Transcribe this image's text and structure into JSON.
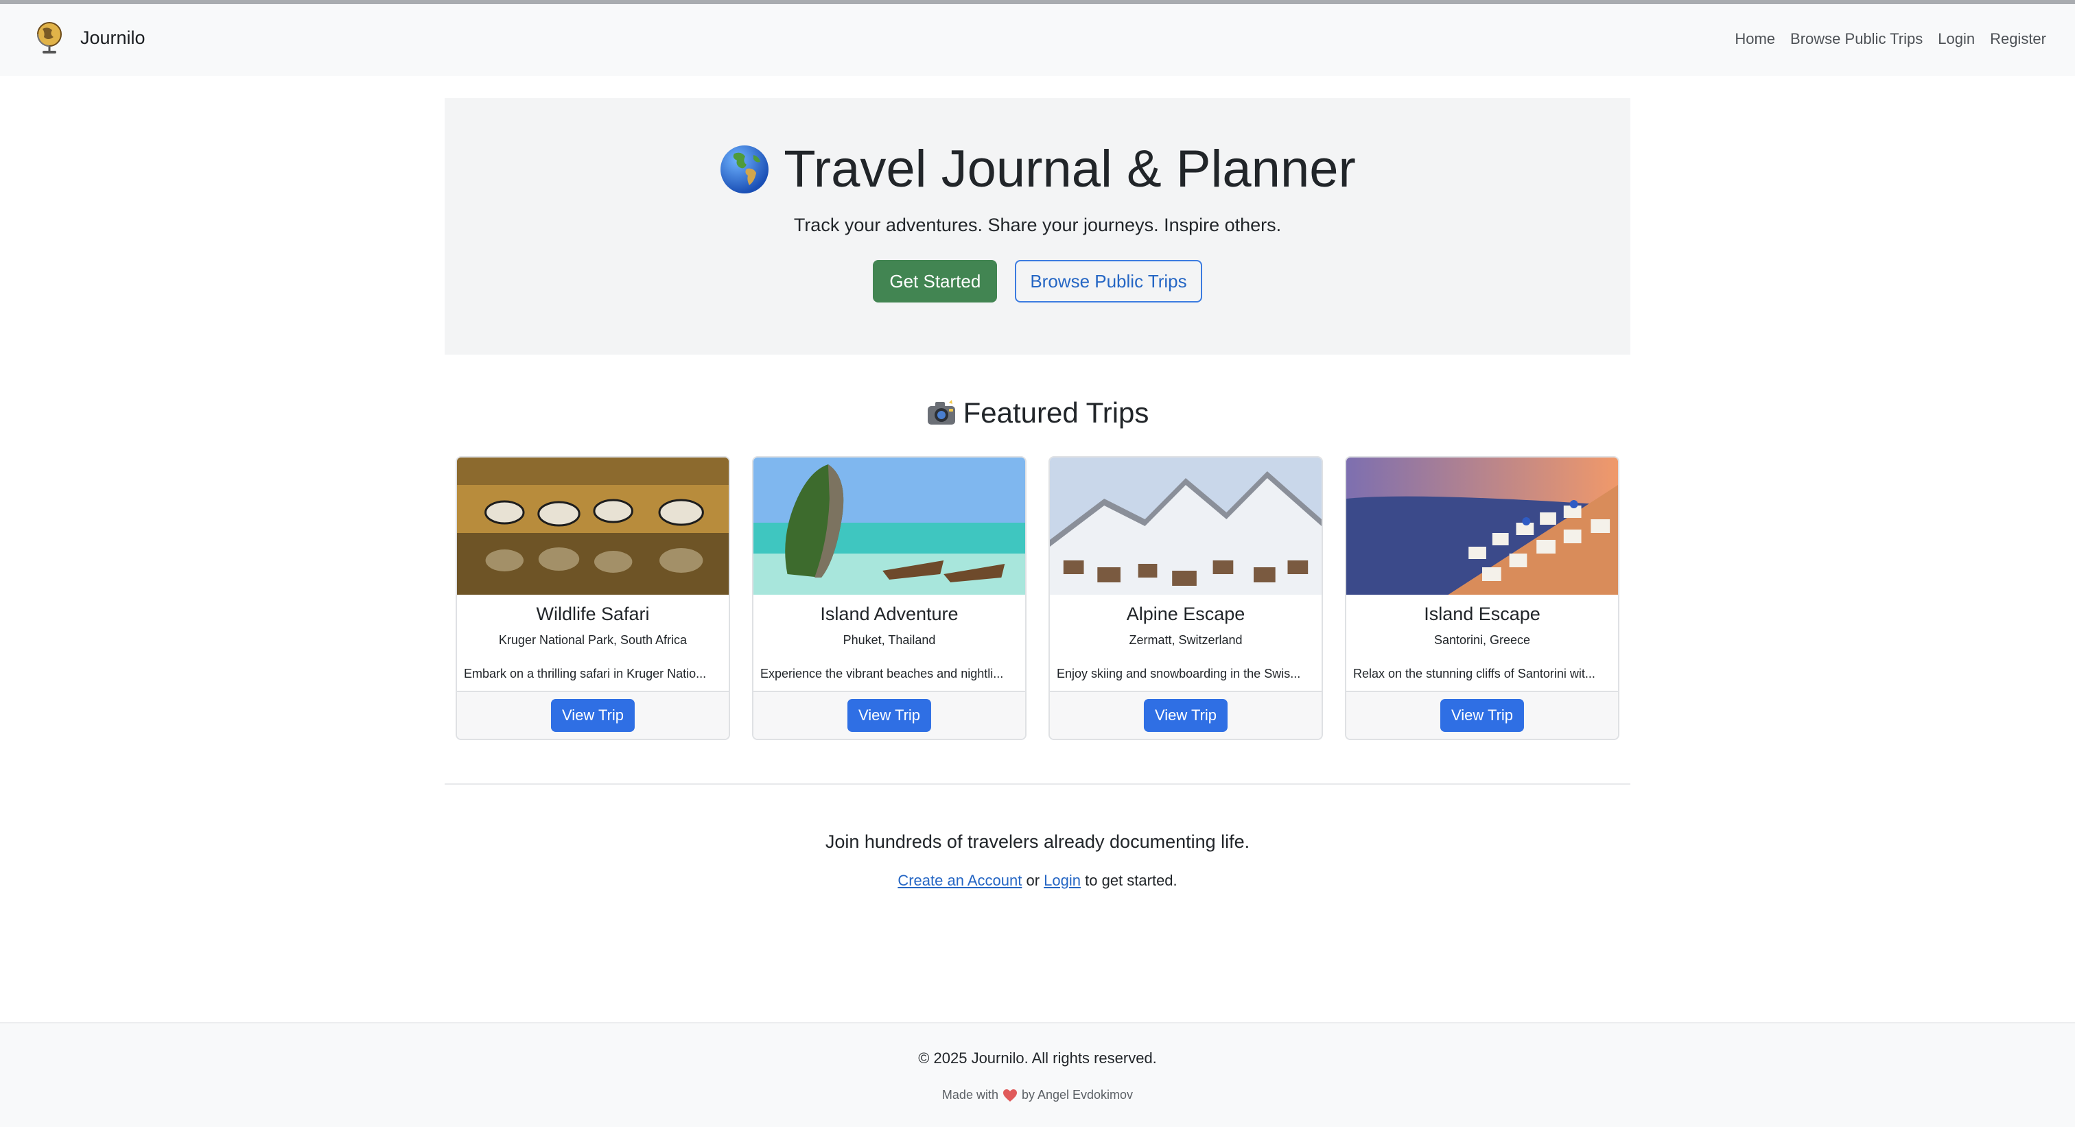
{
  "navbar": {
    "brand": "Journilo",
    "links": [
      "Home",
      "Browse Public Trips",
      "Login",
      "Register"
    ]
  },
  "hero": {
    "title": "Travel Journal & Planner",
    "subtitle": "Track your adventures. Share your journeys. Inspire others.",
    "primary_button": "Get Started",
    "secondary_button": "Browse Public Trips"
  },
  "featured": {
    "heading": "Featured Trips",
    "cards": [
      {
        "title": "Wildlife Safari",
        "location": "Kruger National Park, South Africa",
        "description": "Embark on a thrilling safari in Kruger Natio...",
        "button": "View Trip"
      },
      {
        "title": "Island Adventure",
        "location": "Phuket, Thailand",
        "description": "Experience the vibrant beaches and nightli...",
        "button": "View Trip"
      },
      {
        "title": "Alpine Escape",
        "location": "Zermatt, Switzerland",
        "description": "Enjoy skiing and snowboarding in the Swis...",
        "button": "View Trip"
      },
      {
        "title": "Island Escape",
        "location": "Santorini, Greece",
        "description": "Relax on the stunning cliffs of Santorini wit...",
        "button": "View Trip"
      }
    ]
  },
  "cta": {
    "join_text": "Join hundreds of travelers already documenting life.",
    "create_account": "Create an Account",
    "or": "or",
    "login": "Login",
    "suffix": "to get started."
  },
  "footer": {
    "copyright": "© 2025 Journilo. All rights reserved.",
    "made_with_prefix": "Made with",
    "made_with_suffix": "by Angel Evdokimov"
  },
  "colors": {
    "accent_green": "#428552",
    "accent_blue": "#2f6fe4",
    "link_blue": "#2566c4"
  },
  "icons": [
    "globe-icon",
    "camera-icon",
    "heart-icon",
    "journilo-logo"
  ]
}
